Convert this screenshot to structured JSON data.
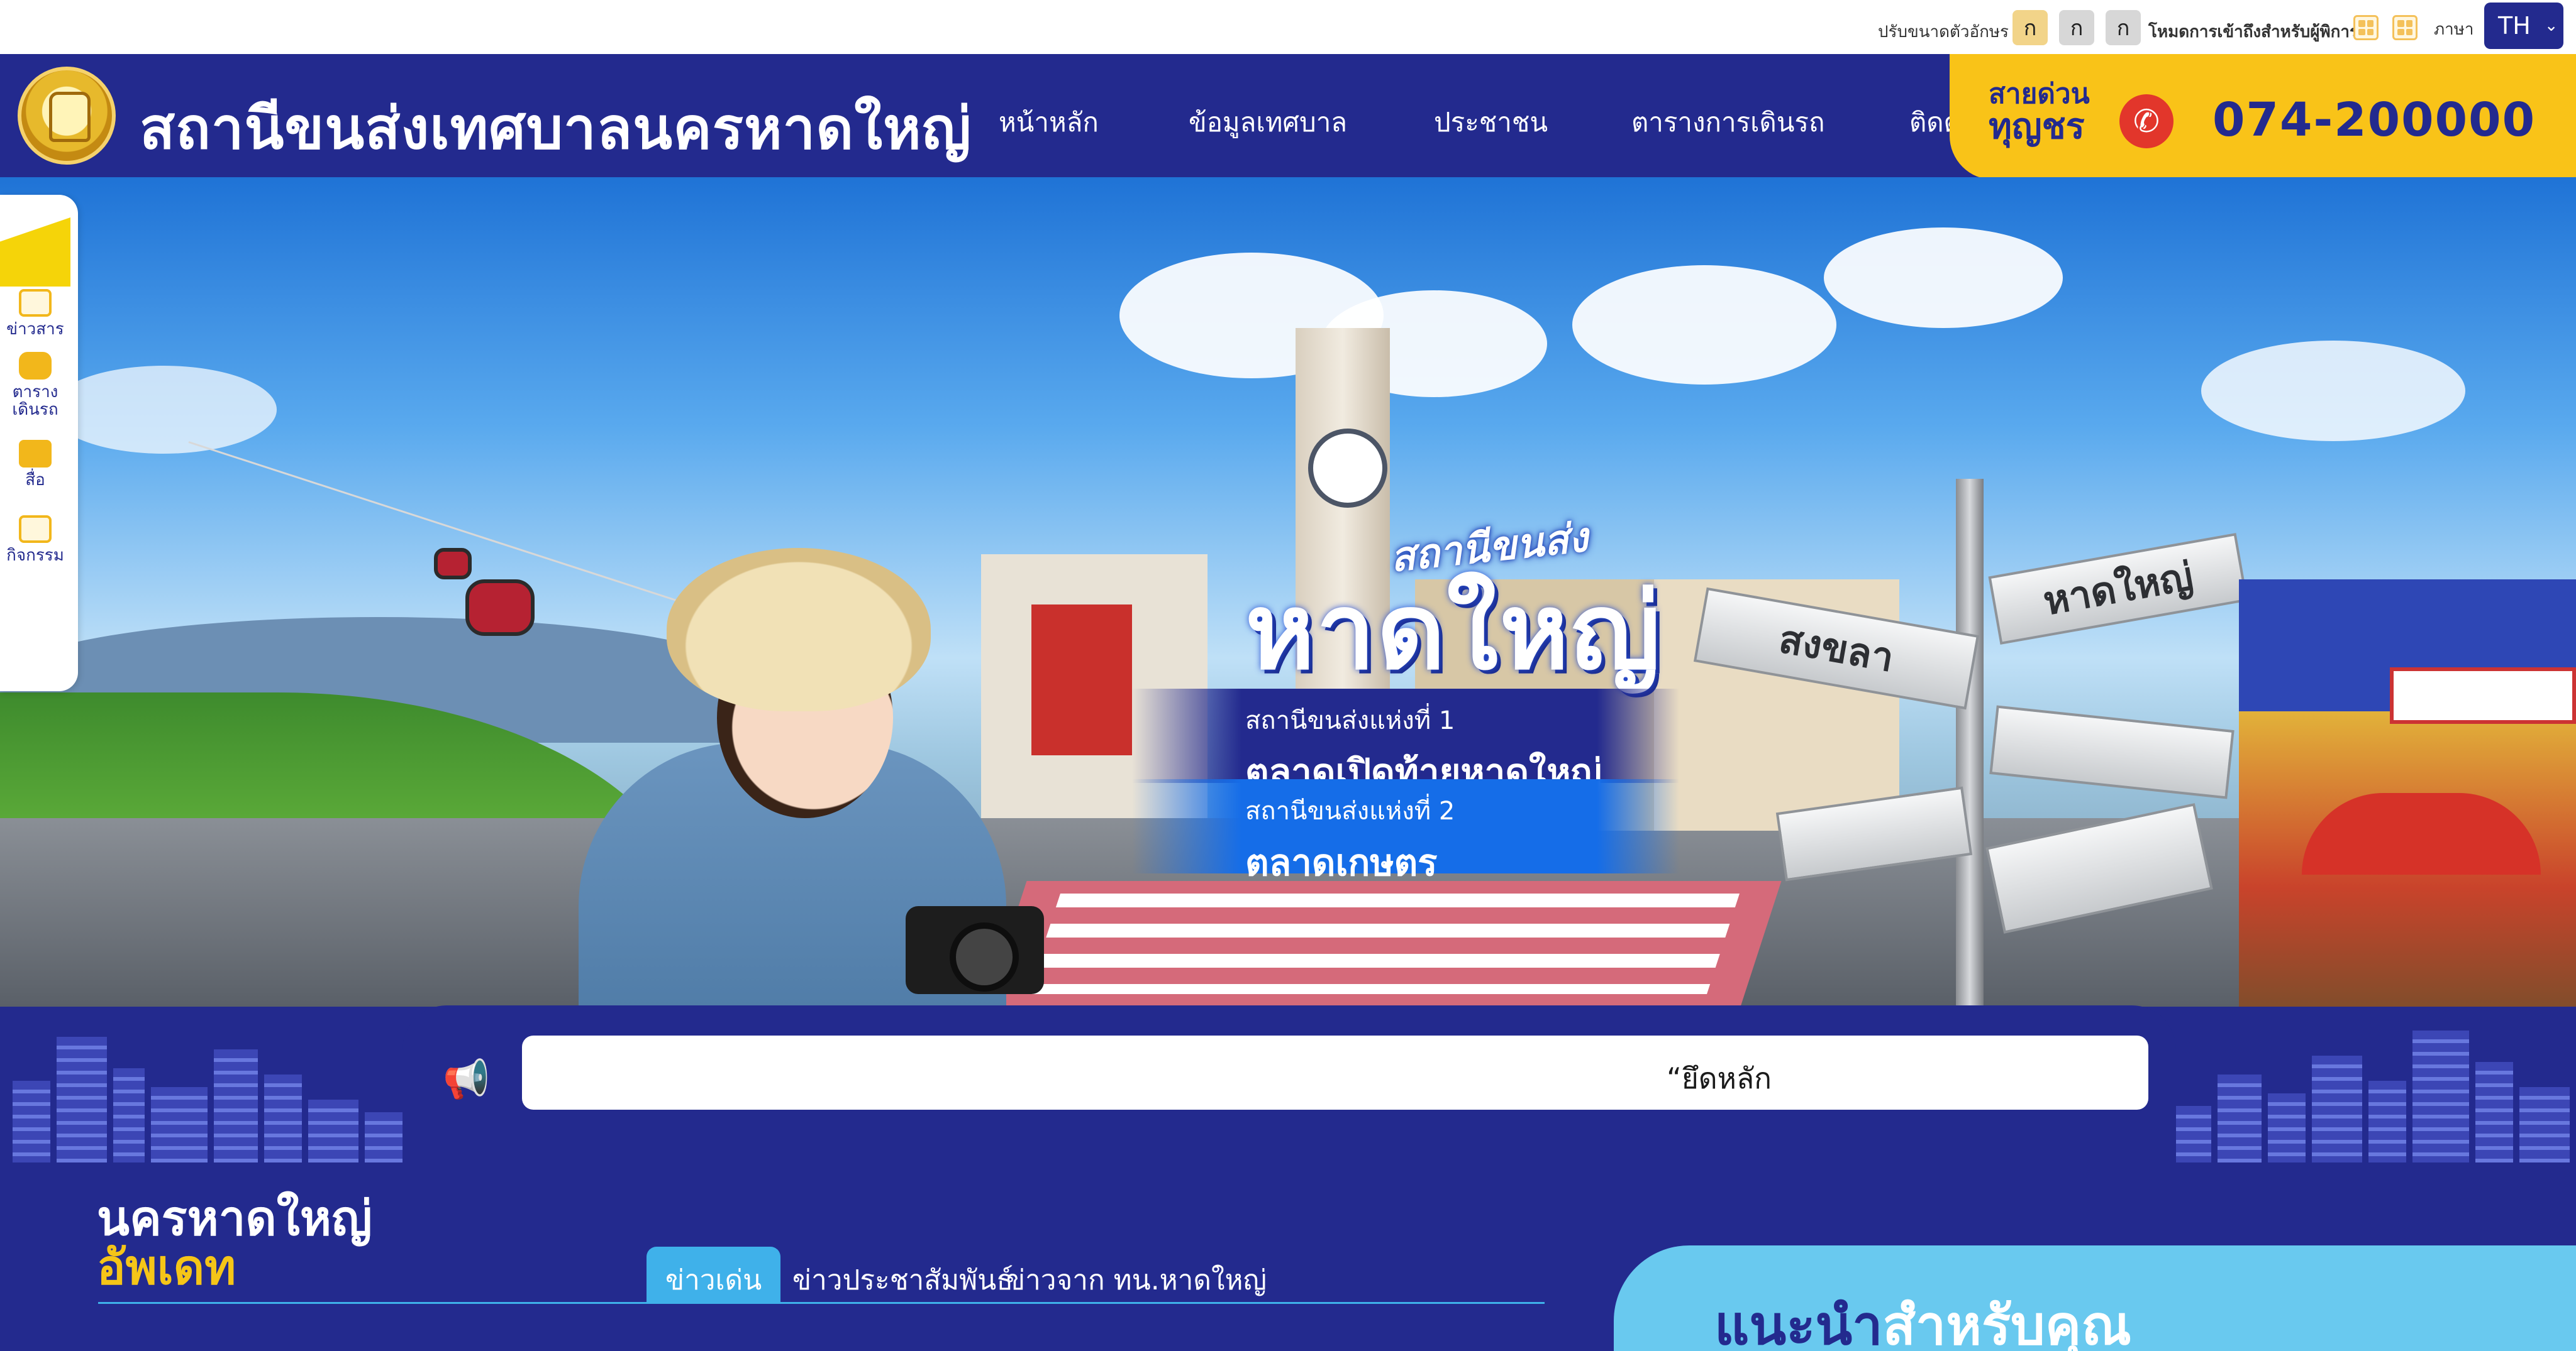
{
  "accessibility": {
    "font_size_label": "ปรับขนาดตัวอักษร",
    "font_sizes": [
      "ก",
      "ก",
      "ก"
    ],
    "access_mode_label": "โหมดการเข้าถึงสำหรับผู้พิการ",
    "language_label": "ภาษา",
    "language_value": "TH"
  },
  "header": {
    "site_title": "สถานีขนส่งเทศบาลนครหาดใหญ่",
    "nav": [
      "หน้าหลัก",
      "ข้อมูลเทศบาล",
      "ประชาชน",
      "ตารางการเดินรถ",
      "ติดต"
    ],
    "hotline": {
      "line1": "สายด่วน",
      "line2": "ทุญชร",
      "number": "074-200000"
    }
  },
  "hero": {
    "script_text": "สถานีขนส่ง",
    "title": "หาดใหญ่",
    "station1_label": "สถานีขนส่งแห่งที่ 1",
    "station1_name": "ตลาดเปิดท้ายหาดใหญ่",
    "station2_label": "สถานีขนส่งแห่งที่ 2",
    "station2_name": "ตลาดเกษตร",
    "sign_songkhla": "สงขลา",
    "sign_hatyai": "หาดใหญ่"
  },
  "side_menu": [
    {
      "label": "ข่าวสาร",
      "icon": "newspaper-icon"
    },
    {
      "label": "ตาราง\nเดินรถ",
      "icon": "bus-icon"
    },
    {
      "label": "สื่อ",
      "icon": "book-icon"
    },
    {
      "label": "กิจกรรม",
      "icon": "image-icon"
    }
  ],
  "announcement": {
    "text": "“ยึดหลัก"
  },
  "news": {
    "heading_line1": "นครหาดใหญ่",
    "heading_line2": "อัพเดท",
    "tabs": [
      "ข่าวเด่น",
      "ข่าวประชาสัมพันธ์",
      "ข่าวจาก ทน.หาดใหญ่"
    ]
  },
  "recommend": {
    "title_part1": "แนะนำ",
    "title_part2": "สำหรับคุณ"
  },
  "colors": {
    "primary": "#232a8e",
    "accent_yellow": "#f9c318",
    "accent_blue": "#3fb1ea"
  }
}
